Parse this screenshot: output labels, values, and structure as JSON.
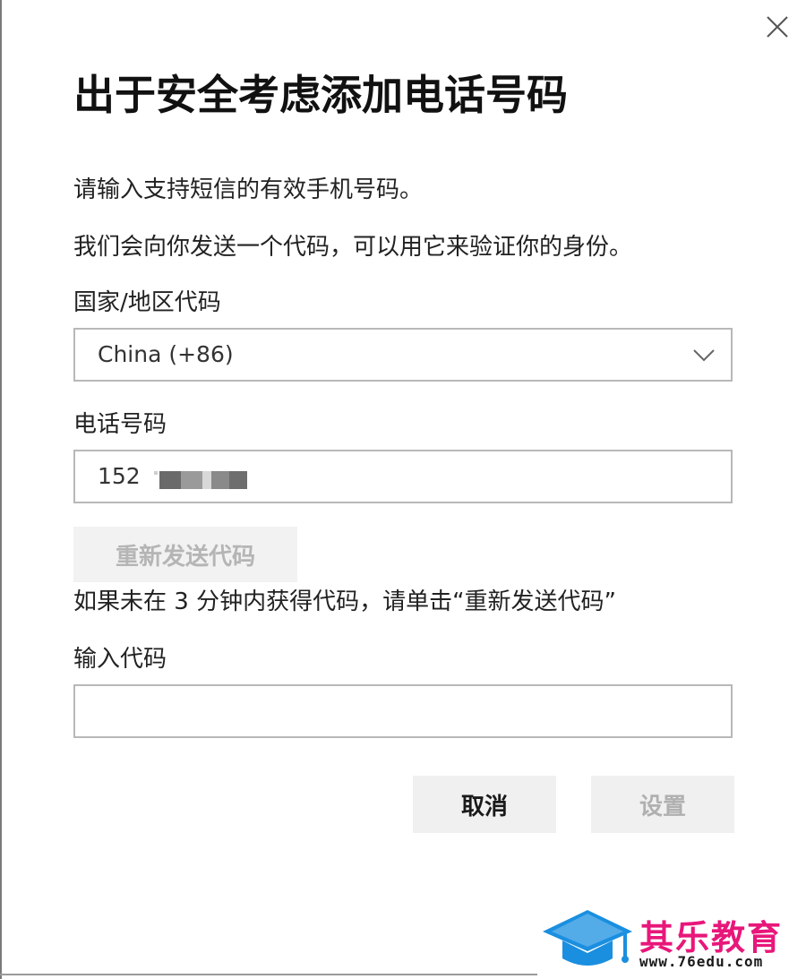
{
  "dialog": {
    "title": "出于安全考虑添加电话号码",
    "instruction_1": "请输入支持短信的有效手机号码。",
    "instruction_2": "我们会向你发送一个代码，可以用它来验证你的身份。"
  },
  "country": {
    "label": "国家/地区代码",
    "selected": "China (+86)"
  },
  "phone": {
    "label": "电话号码",
    "value_visible": "152"
  },
  "resend": {
    "label": "重新发送代码",
    "hint": "如果未在 3 分钟内获得代码，请单击“重新发送代码”"
  },
  "code": {
    "label": "输入代码",
    "value": ""
  },
  "actions": {
    "cancel_label": "取消",
    "set_label": "设置"
  },
  "watermark": {
    "brand": "其乐教育",
    "url": "www.76edu.com"
  },
  "colors": {
    "watermark_pink": "#e8177a",
    "watermark_blue": "#1a8fe0",
    "disabled_text": "#b5b5b5"
  }
}
